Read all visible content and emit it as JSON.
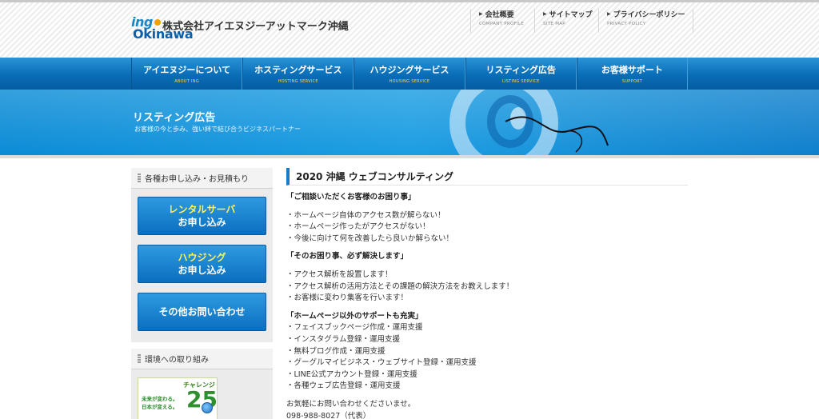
{
  "header": {
    "logo_ing": "ing",
    "logo_okinawa": "Okinawa",
    "company_name": "株式会社アイエヌジーアットマーク沖縄",
    "util_links": [
      {
        "jp": "会社概要",
        "en": "COMPANY PROFILE"
      },
      {
        "jp": "サイトマップ",
        "en": "SITE MAP"
      },
      {
        "jp": "プライバシーポリシー",
        "en": "PRIVACY POLICY"
      }
    ]
  },
  "nav": {
    "items": [
      {
        "jp": "アイエヌジーについて",
        "en": "ABOUT ING"
      },
      {
        "jp": "ホスティングサービス",
        "en": "HOSTING SERVICE"
      },
      {
        "jp": "ハウジングサービス",
        "en": "HOUSING SERVICE"
      },
      {
        "jp": "リスティング広告",
        "en": "LISTING SERVICE"
      },
      {
        "jp": "お客様サポート",
        "en": "SUPPORT"
      }
    ]
  },
  "banner": {
    "title": "リスティング広告",
    "subtitle": "お客様の今と歩み、強い絆で結び合うビジネスパートナー"
  },
  "sidebar": {
    "apply_title": "各種お申し込み・お見積もり",
    "buttons": [
      {
        "line1": "レンタルサーバ",
        "line2": "お申し込み"
      },
      {
        "line1": "ハウジング",
        "line2": "お申し込み"
      },
      {
        "line1": "",
        "line2": "その他お問い合わせ"
      }
    ],
    "eco_title": "環境への取り組み",
    "eco_banner": {
      "challenge": "チャレンジ",
      "number": "25",
      "slogan1": "未来が変わる。",
      "slogan2": "日本が変える。"
    }
  },
  "main": {
    "heading": "2020 沖縄 ウェブコンサルティング",
    "sections": [
      {
        "title": "「ご相談いただくお客様のお困り事」",
        "lines": [
          "・ホームページ自体のアクセス数が解らない！",
          "・ホームページ作ったがアクセスがない！",
          "・今後に向けて何を改善したら良いか解らない！"
        ]
      },
      {
        "title": "「そのお困り事、必ず解決します」",
        "lines": [
          "・アクセス解析を設置します！",
          "・アクセス解析の活用方法とその課題の解決方法をお教えします！",
          "・お客様に変わり集客を行います！"
        ]
      },
      {
        "title": "「ホームページ以外のサポートも充実」",
        "lines": [
          "・フェイスブックページ作成・運用支援",
          "・インスタグラム登録・運用支援",
          "・無料ブログ作成・運用支援",
          "・グーグルマイビジネス・ウェブサイト登録・運用支援",
          "・LINE公式アカウント登録・運用支援",
          "・各種ウェブ広告登録・運用支援"
        ]
      }
    ],
    "contact_text": "お気軽にお問い合わせくださいませ。",
    "contact_phone": "098-988-8027（代表）"
  }
}
